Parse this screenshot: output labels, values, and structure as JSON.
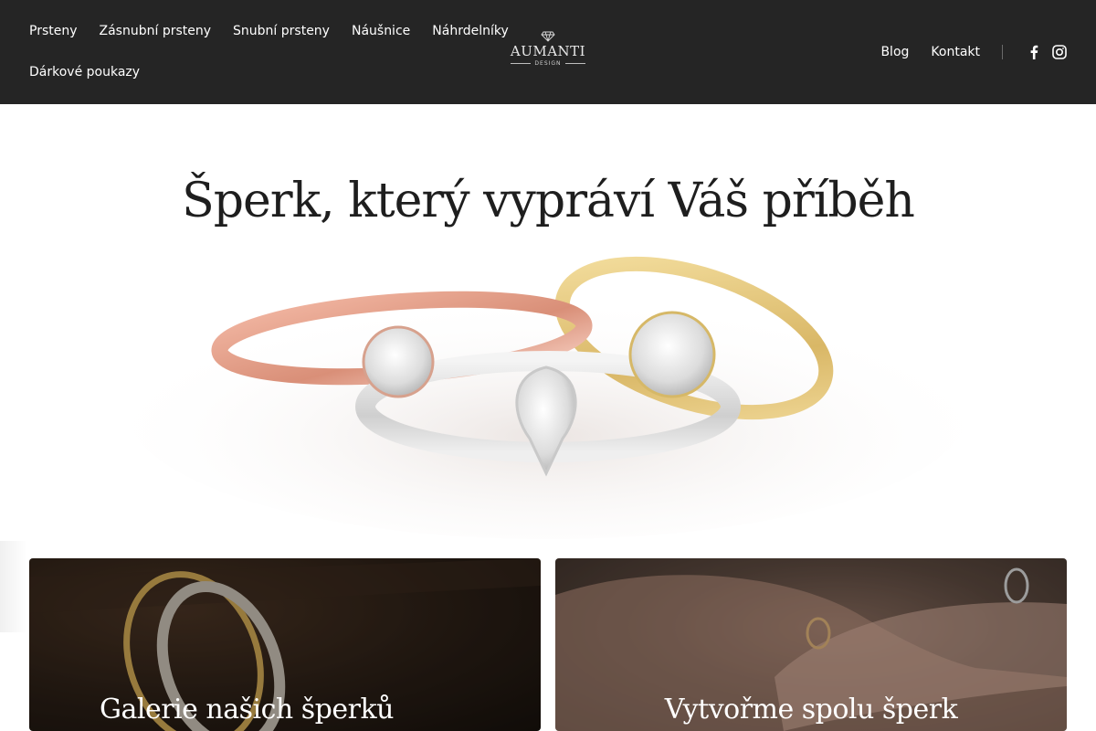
{
  "header": {
    "nav_left_row1": [
      "Prsteny",
      "Zásnubní prsteny",
      "Snubní prsteny",
      "Náušnice",
      "Náhrdelníky"
    ],
    "nav_left_row2": [
      "Dárkové poukazy"
    ],
    "logo": {
      "word": "AUMANTI",
      "sub": "DESIGN"
    },
    "nav_right": [
      "Blog",
      "Kontakt"
    ],
    "social": [
      "facebook-icon",
      "instagram-icon"
    ]
  },
  "hero": {
    "title": "Šperk, který vypráví Váš příběh",
    "image": "rings-photo"
  },
  "cards": [
    {
      "title": "Galerie našich šperků",
      "image": "ring-on-wood-photo"
    },
    {
      "title": "Vytvořme spolu šperk",
      "image": "hands-with-ring-photo"
    }
  ],
  "colors": {
    "header_bg": "#252525",
    "text_dark": "#1e1e1e",
    "white": "#ffffff"
  }
}
